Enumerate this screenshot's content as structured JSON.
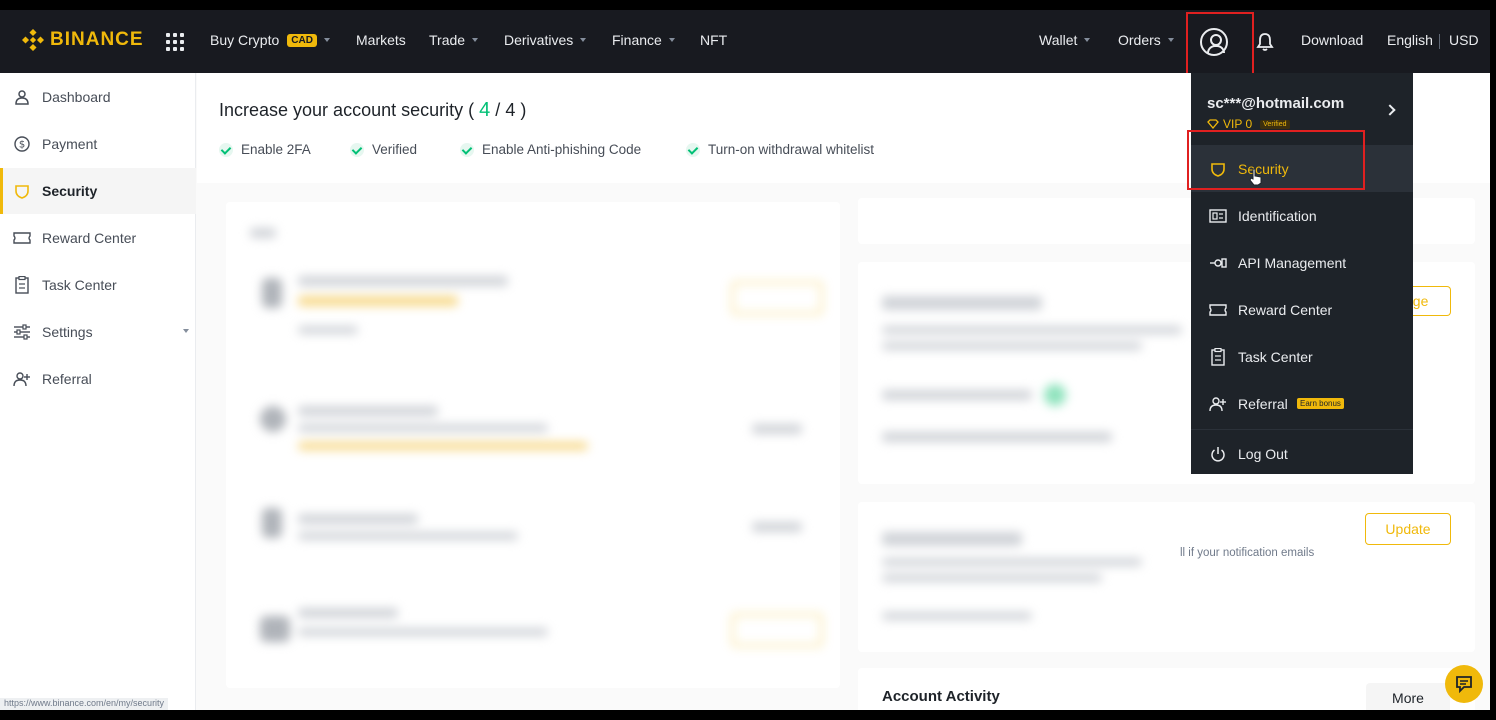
{
  "brand": {
    "name": "BINANCE",
    "color": "#f0b90b"
  },
  "topnav": {
    "items": [
      {
        "label": "Buy Crypto",
        "badge": "CAD",
        "has_caret": true
      },
      {
        "label": "Markets",
        "has_caret": false
      },
      {
        "label": "Trade",
        "has_caret": true
      },
      {
        "label": "Derivatives",
        "has_caret": true
      },
      {
        "label": "Finance",
        "has_caret": true
      },
      {
        "label": "NFT",
        "has_caret": false
      }
    ],
    "right": {
      "wallet": "Wallet",
      "orders": "Orders",
      "download": "Download",
      "language": "English",
      "currency": "USD"
    }
  },
  "sidebar": {
    "items": [
      {
        "label": "Dashboard",
        "icon": "user-icon"
      },
      {
        "label": "Payment",
        "icon": "dollar-icon"
      },
      {
        "label": "Security",
        "icon": "shield-icon",
        "active": true
      },
      {
        "label": "Reward Center",
        "icon": "ticket-icon"
      },
      {
        "label": "Task Center",
        "icon": "clipboard-icon"
      },
      {
        "label": "Settings",
        "icon": "sliders-icon",
        "has_caret": true
      },
      {
        "label": "Referral",
        "icon": "user-plus-icon"
      }
    ]
  },
  "banner": {
    "title_prefix": "Increase your account security (",
    "done": "4",
    "sep": "/",
    "total": "4",
    "title_suffix": ")",
    "checks": [
      "Enable 2FA",
      "Verified",
      "Enable Anti-phishing Code",
      "Turn-on withdrawal whitelist"
    ]
  },
  "main": {
    "update_label": "Update",
    "manage_label_partial": "age",
    "notif_text": "ll if your notification emails",
    "account_activity": "Account Activity",
    "more_label": "More"
  },
  "dropdown": {
    "email": "sc***@hotmail.com",
    "vip": "VIP 0",
    "verified": "Verified",
    "items": [
      {
        "label": "Security",
        "icon": "shield-icon",
        "active": true
      },
      {
        "label": "Identification",
        "icon": "id-card-icon"
      },
      {
        "label": "API Management",
        "icon": "api-icon"
      },
      {
        "label": "Reward Center",
        "icon": "ticket-icon"
      },
      {
        "label": "Task Center",
        "icon": "clipboard-icon"
      },
      {
        "label": "Referral",
        "icon": "user-plus-icon",
        "badge": "Earn bonus"
      }
    ],
    "logout": "Log Out"
  },
  "status_url": "https://www.binance.com/en/my/security"
}
